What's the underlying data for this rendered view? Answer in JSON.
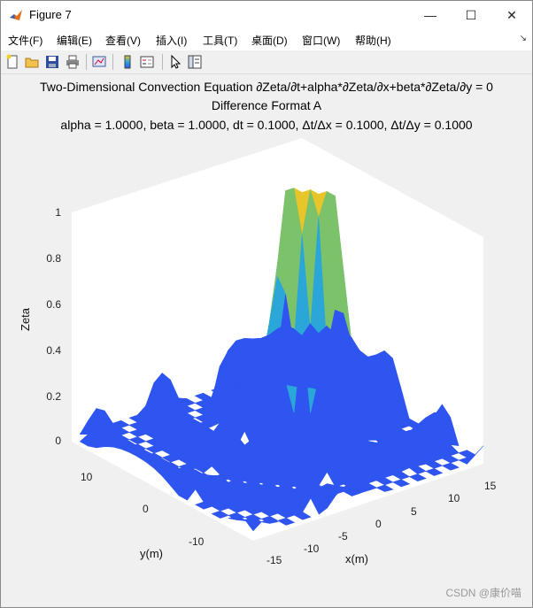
{
  "window": {
    "title": "Figure 7",
    "minimize_glyph": "—",
    "maximize_glyph": "☐",
    "close_glyph": "✕"
  },
  "menu": {
    "items": [
      "文件(F)",
      "编辑(E)",
      "查看(V)",
      "插入(I)",
      "工具(T)",
      "桌面(D)",
      "窗口(W)",
      "帮助(H)"
    ],
    "overflow_glyph": "↘"
  },
  "toolbar": {
    "icons": [
      "new-figure-icon",
      "open-file-icon",
      "save-icon",
      "print-icon",
      "link-plot-icon",
      "colorbar-icon",
      "legend-icon",
      "edit-plot-arrow-icon",
      "property-inspector-icon"
    ]
  },
  "plot": {
    "title_line1": "Two-Dimensional Convection Equation ∂Zeta/∂t+alpha*∂Zeta/∂x+beta*∂Zeta/∂y = 0",
    "title_line2": "Difference Format A",
    "title_line3": "alpha = 1.0000, beta = 1.0000, dt = 0.1000, Δt/Δx = 0.1000, Δt/Δy = 0.1000",
    "zlabel": "Zeta",
    "ylabel": "y(m)",
    "xlabel": "x(m)",
    "z_ticks": [
      "0",
      "0.2",
      "0.4",
      "0.6",
      "0.8",
      "1"
    ],
    "y_ticks": [
      "10",
      "0",
      "-10"
    ],
    "x_ticks": [
      "-15",
      "-10",
      "-5",
      "0",
      "5",
      "10",
      "15"
    ]
  },
  "colors": {
    "surface_low": "#2f55f0",
    "surface_mid": "#2aa6d8",
    "surface_high": "#7cc26a",
    "surface_top": "#e8c62a"
  },
  "watermark": "CSDN @康价喵"
}
